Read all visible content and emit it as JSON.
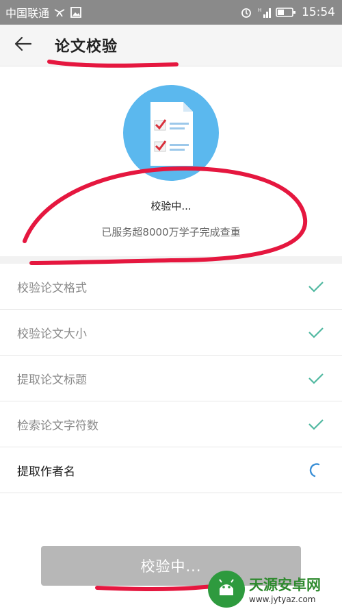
{
  "status_bar": {
    "carrier": "中国联通",
    "time": "15:54"
  },
  "header": {
    "title": "论文校验",
    "back_icon": "arrow-left-icon"
  },
  "hero": {
    "illustration": "checklist-document-icon",
    "status": "校验中...",
    "served_text": "已服务超8000万学子完成查重"
  },
  "checklist": {
    "items": [
      {
        "label": "校验论文格式",
        "status": "done"
      },
      {
        "label": "校验论文大小",
        "status": "done"
      },
      {
        "label": "提取论文标题",
        "status": "done"
      },
      {
        "label": "检索论文字符数",
        "status": "done"
      },
      {
        "label": "提取作者名",
        "status": "in-progress"
      }
    ]
  },
  "button": {
    "label": "校验中..."
  },
  "watermark": {
    "name": "天源安卓网",
    "url": "www.jytyaz.com"
  },
  "colors": {
    "accent_check": "#4fb8a0",
    "annotation_red": "#e5173f",
    "hero_blue": "#5bb8ee",
    "button_gray": "#b7b7b7"
  }
}
